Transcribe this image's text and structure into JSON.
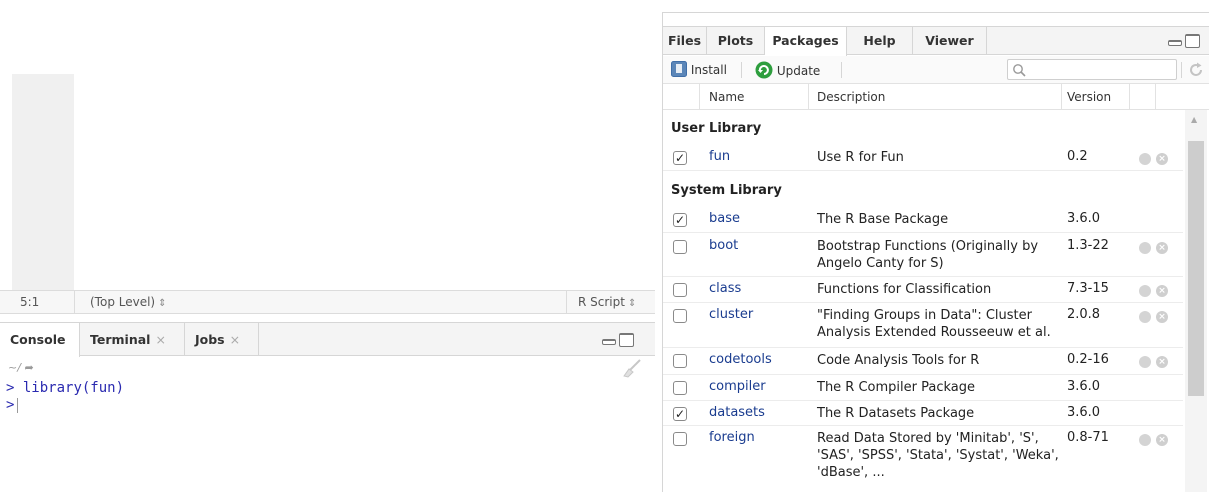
{
  "editor": {
    "status": {
      "position": "5:1",
      "scope": "(Top Level)",
      "file_type": "R Script"
    }
  },
  "console": {
    "tabs": [
      {
        "label": "Console"
      },
      {
        "label": "Terminal"
      },
      {
        "label": "Jobs"
      }
    ],
    "path": "~/",
    "lines": [
      {
        "prompt": ">",
        "text": "library(fun)"
      },
      {
        "prompt": ">",
        "text": ""
      }
    ]
  },
  "packages_pane": {
    "tabs": [
      {
        "label": "Files"
      },
      {
        "label": "Plots"
      },
      {
        "label": "Packages"
      },
      {
        "label": "Help"
      },
      {
        "label": "Viewer"
      }
    ],
    "toolbar": {
      "install_label": "Install",
      "update_label": "Update",
      "search_placeholder": ""
    },
    "columns": {
      "name": "Name",
      "description": "Description",
      "version": "Version"
    },
    "user_library": {
      "title": "User Library",
      "packages": [
        {
          "name": "fun",
          "description": "Use R for Fun",
          "version": "0.2",
          "checked": true
        }
      ]
    },
    "system_library": {
      "title": "System Library",
      "packages": [
        {
          "name": "base",
          "description": "The R Base Package",
          "version": "3.6.0",
          "checked": true
        },
        {
          "name": "boot",
          "description": "Bootstrap Functions (Originally by Angelo Canty for S)",
          "version": "1.3-22",
          "checked": false
        },
        {
          "name": "class",
          "description": "Functions for Classification",
          "version": "7.3-15",
          "checked": false
        },
        {
          "name": "cluster",
          "description": "\"Finding Groups in Data\": Cluster Analysis Extended Rousseeuw et al.",
          "version": "2.0.8",
          "checked": false
        },
        {
          "name": "codetools",
          "description": "Code Analysis Tools for R",
          "version": "0.2-16",
          "checked": false
        },
        {
          "name": "compiler",
          "description": "The R Compiler Package",
          "version": "3.6.0",
          "checked": false
        },
        {
          "name": "datasets",
          "description": "The R Datasets Package",
          "version": "3.6.0",
          "checked": true
        },
        {
          "name": "foreign",
          "description": "Read Data Stored by 'Minitab', 'S', 'SAS', 'SPSS', 'Stata', 'Systat', 'Weka', 'dBase', ...",
          "version": "0.8-71",
          "checked": false
        }
      ]
    }
  },
  "colors": {
    "package_link": "#1a3c8f",
    "console_text": "#2a2ab0",
    "update_icon": "#2e9e3e",
    "install_icon": "#3f6ea8"
  }
}
